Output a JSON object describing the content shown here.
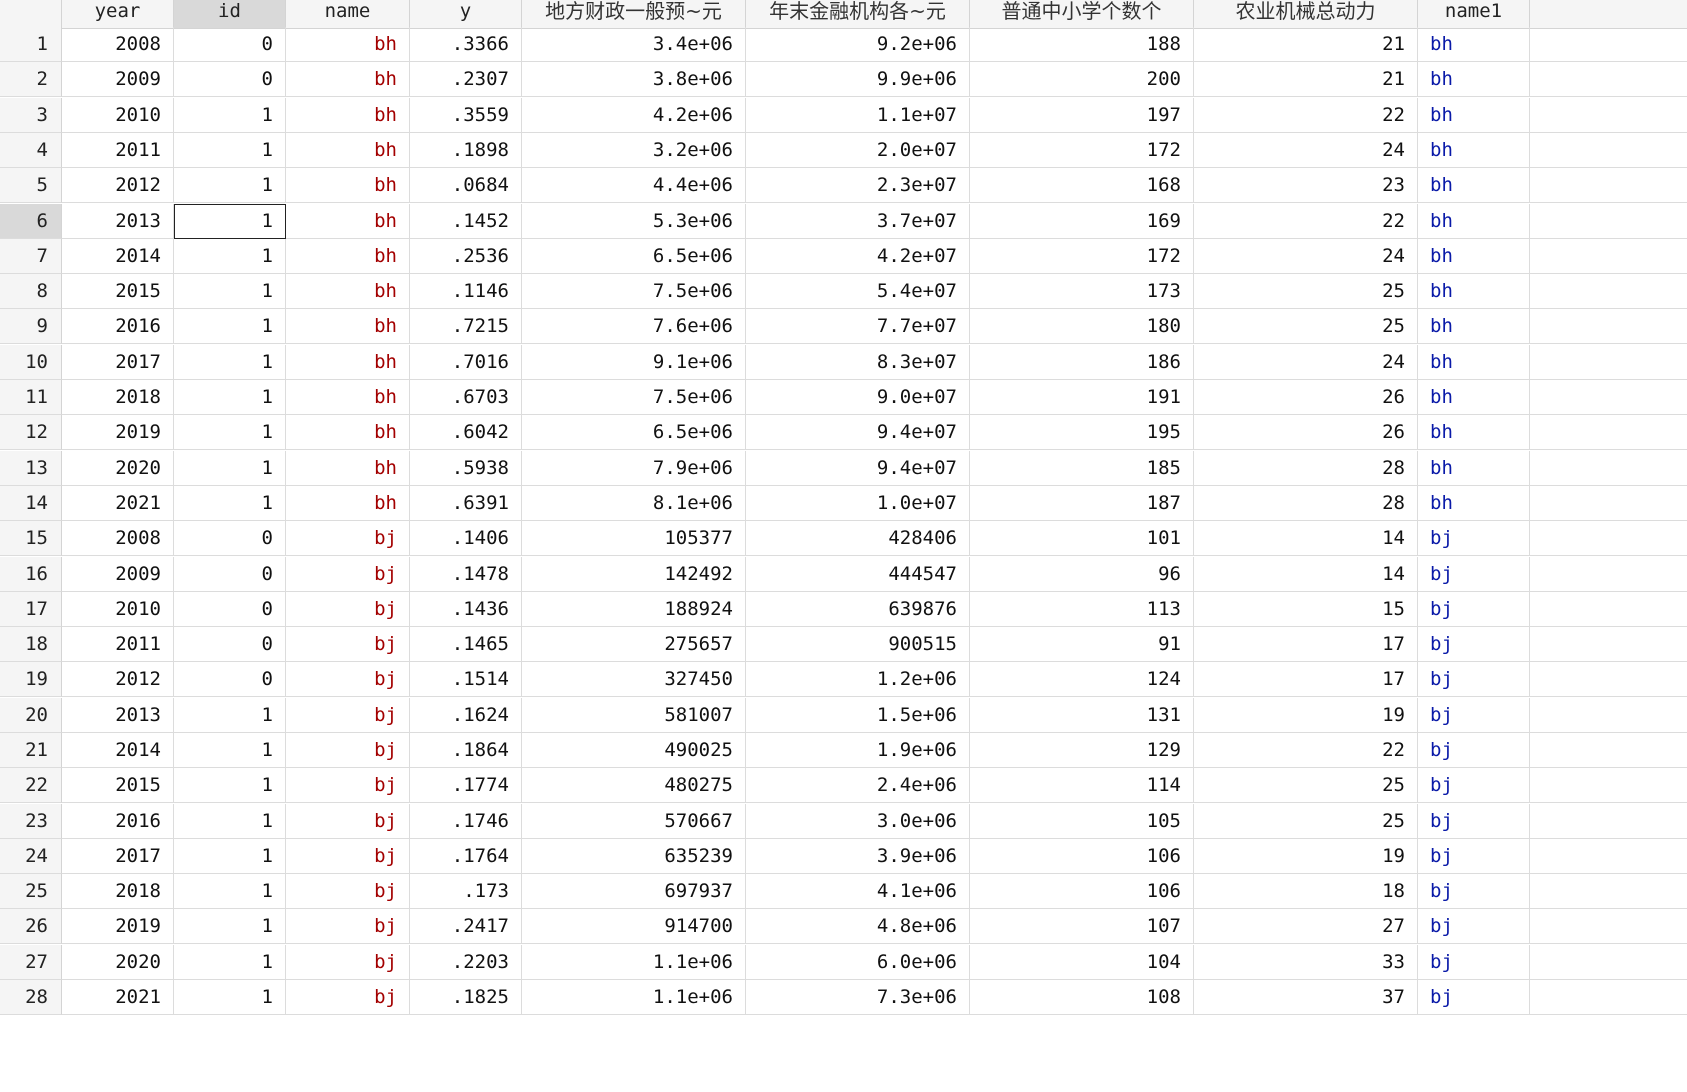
{
  "columns": [
    {
      "label": "",
      "align": "right"
    },
    {
      "label": "year",
      "align": "right"
    },
    {
      "label": "id",
      "align": "right"
    },
    {
      "label": "name",
      "align": "right"
    },
    {
      "label": "y",
      "align": "right"
    },
    {
      "label": "地方财政一般预~元",
      "align": "right"
    },
    {
      "label": "年末金融机构各~元",
      "align": "right"
    },
    {
      "label": "普通中小学个数个",
      "align": "right"
    },
    {
      "label": "农业机械总动力",
      "align": "right"
    },
    {
      "label": "name1",
      "align": "left"
    }
  ],
  "selected_row_index": 5,
  "selected_column_index": 2,
  "colors": {
    "string_value": "#a30000",
    "labeled_value": "#0a1aa8",
    "header_bg": "#f5f5f5",
    "selected_header_bg": "#d9d9d9"
  },
  "rows": [
    [
      "1",
      "2008",
      "0",
      "bh",
      ".3366",
      "3.4e+06",
      "9.2e+06",
      "188",
      "21",
      "bh"
    ],
    [
      "2",
      "2009",
      "0",
      "bh",
      ".2307",
      "3.8e+06",
      "9.9e+06",
      "200",
      "21",
      "bh"
    ],
    [
      "3",
      "2010",
      "1",
      "bh",
      ".3559",
      "4.2e+06",
      "1.1e+07",
      "197",
      "22",
      "bh"
    ],
    [
      "4",
      "2011",
      "1",
      "bh",
      ".1898",
      "3.2e+06",
      "2.0e+07",
      "172",
      "24",
      "bh"
    ],
    [
      "5",
      "2012",
      "1",
      "bh",
      ".0684",
      "4.4e+06",
      "2.3e+07",
      "168",
      "23",
      "bh"
    ],
    [
      "6",
      "2013",
      "1",
      "bh",
      ".1452",
      "5.3e+06",
      "3.7e+07",
      "169",
      "22",
      "bh"
    ],
    [
      "7",
      "2014",
      "1",
      "bh",
      ".2536",
      "6.5e+06",
      "4.2e+07",
      "172",
      "24",
      "bh"
    ],
    [
      "8",
      "2015",
      "1",
      "bh",
      ".1146",
      "7.5e+06",
      "5.4e+07",
      "173",
      "25",
      "bh"
    ],
    [
      "9",
      "2016",
      "1",
      "bh",
      ".7215",
      "7.6e+06",
      "7.7e+07",
      "180",
      "25",
      "bh"
    ],
    [
      "10",
      "2017",
      "1",
      "bh",
      ".7016",
      "9.1e+06",
      "8.3e+07",
      "186",
      "24",
      "bh"
    ],
    [
      "11",
      "2018",
      "1",
      "bh",
      ".6703",
      "7.5e+06",
      "9.0e+07",
      "191",
      "26",
      "bh"
    ],
    [
      "12",
      "2019",
      "1",
      "bh",
      ".6042",
      "6.5e+06",
      "9.4e+07",
      "195",
      "26",
      "bh"
    ],
    [
      "13",
      "2020",
      "1",
      "bh",
      ".5938",
      "7.9e+06",
      "9.4e+07",
      "185",
      "28",
      "bh"
    ],
    [
      "14",
      "2021",
      "1",
      "bh",
      ".6391",
      "8.1e+06",
      "1.0e+07",
      "187",
      "28",
      "bh"
    ],
    [
      "15",
      "2008",
      "0",
      "bj",
      ".1406",
      "105377",
      "428406",
      "101",
      "14",
      "bj"
    ],
    [
      "16",
      "2009",
      "0",
      "bj",
      ".1478",
      "142492",
      "444547",
      "96",
      "14",
      "bj"
    ],
    [
      "17",
      "2010",
      "0",
      "bj",
      ".1436",
      "188924",
      "639876",
      "113",
      "15",
      "bj"
    ],
    [
      "18",
      "2011",
      "0",
      "bj",
      ".1465",
      "275657",
      "900515",
      "91",
      "17",
      "bj"
    ],
    [
      "19",
      "2012",
      "0",
      "bj",
      ".1514",
      "327450",
      "1.2e+06",
      "124",
      "17",
      "bj"
    ],
    [
      "20",
      "2013",
      "1",
      "bj",
      ".1624",
      "581007",
      "1.5e+06",
      "131",
      "19",
      "bj"
    ],
    [
      "21",
      "2014",
      "1",
      "bj",
      ".1864",
      "490025",
      "1.9e+06",
      "129",
      "22",
      "bj"
    ],
    [
      "22",
      "2015",
      "1",
      "bj",
      ".1774",
      "480275",
      "2.4e+06",
      "114",
      "25",
      "bj"
    ],
    [
      "23",
      "2016",
      "1",
      "bj",
      ".1746",
      "570667",
      "3.0e+06",
      "105",
      "25",
      "bj"
    ],
    [
      "24",
      "2017",
      "1",
      "bj",
      ".1764",
      "635239",
      "3.9e+06",
      "106",
      "19",
      "bj"
    ],
    [
      "25",
      "2018",
      "1",
      "bj",
      ".173",
      "697937",
      "4.1e+06",
      "106",
      "18",
      "bj"
    ],
    [
      "26",
      "2019",
      "1",
      "bj",
      ".2417",
      "914700",
      "4.8e+06",
      "107",
      "27",
      "bj"
    ],
    [
      "27",
      "2020",
      "1",
      "bj",
      ".2203",
      "1.1e+06",
      "6.0e+06",
      "104",
      "33",
      "bj"
    ],
    [
      "28",
      "2021",
      "1",
      "bj",
      ".1825",
      "1.1e+06",
      "7.3e+06",
      "108",
      "37",
      "bj"
    ]
  ]
}
